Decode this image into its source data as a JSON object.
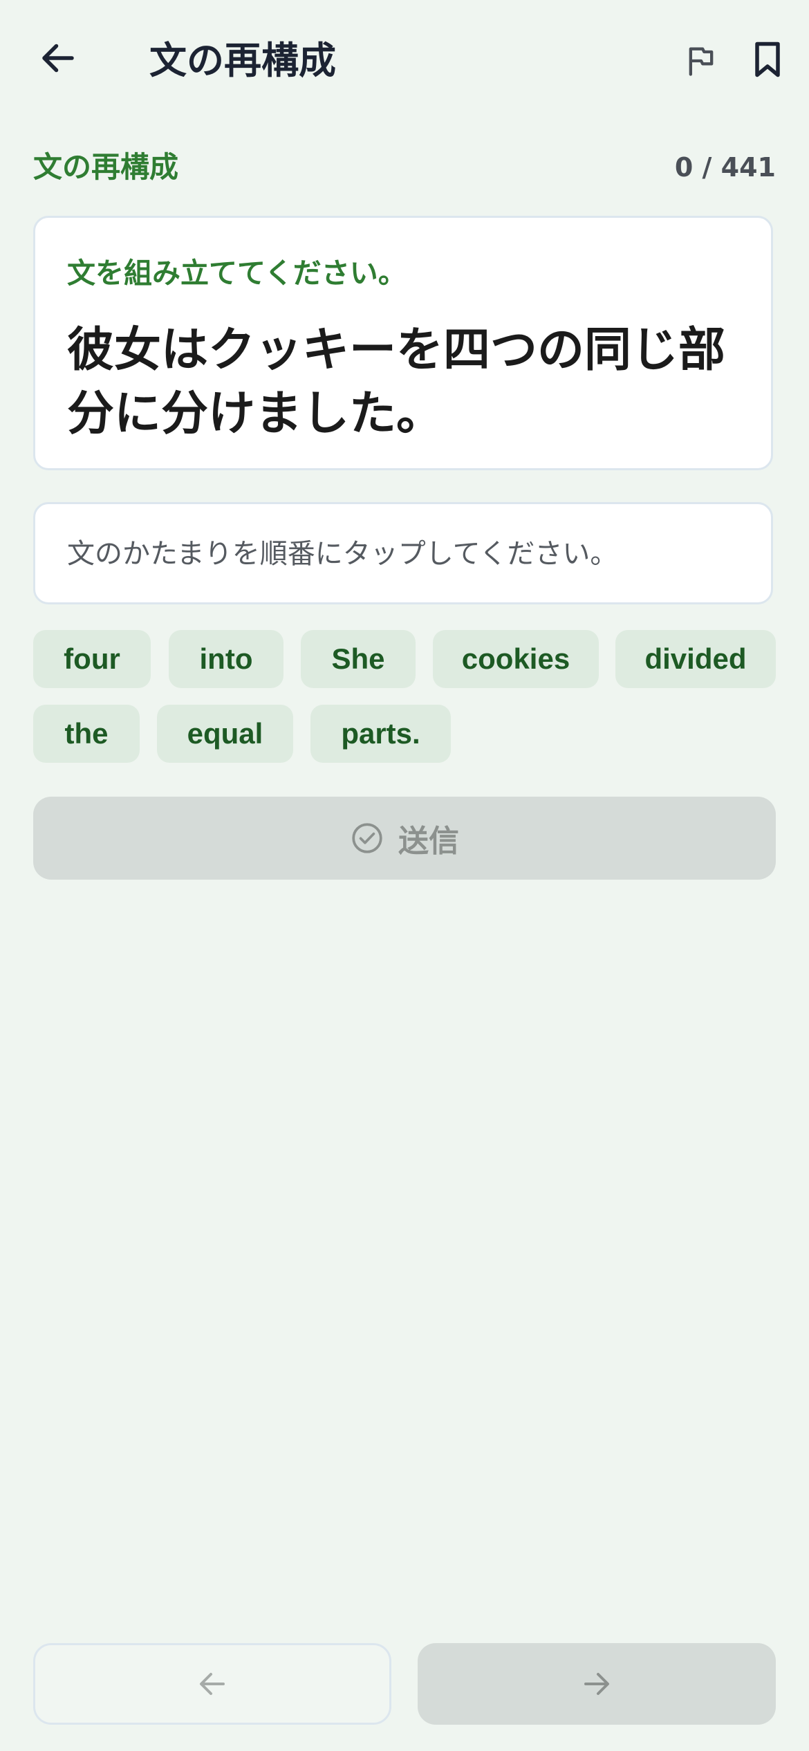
{
  "appbar": {
    "title": "文の再構成",
    "back_icon": "arrow-left-icon",
    "flag_icon": "flag-icon",
    "bookmark_icon": "bookmark-icon"
  },
  "section": {
    "label": "文の再構成",
    "progress": "0 / 441"
  },
  "prompt": {
    "instruction": "文を組み立ててください。",
    "sentence": "彼女はクッキーを四つの同じ部分に分けました。"
  },
  "answer": {
    "placeholder": "文のかたまりを順番にタップしてください。"
  },
  "word_tiles": [
    "four",
    "into",
    "She",
    "cookies",
    "divided",
    "the",
    "equal",
    "parts."
  ],
  "submit": {
    "label": "送信",
    "icon": "check-circle-icon"
  },
  "navigation": {
    "prev_icon": "arrow-left-icon",
    "next_icon": "arrow-right-icon"
  },
  "colors": {
    "background": "#eff5f0",
    "accent_green": "#2f7d32",
    "tile_bg": "#deebe0",
    "tile_text": "#1d5a24",
    "disabled_button": "#d5dbd8"
  }
}
